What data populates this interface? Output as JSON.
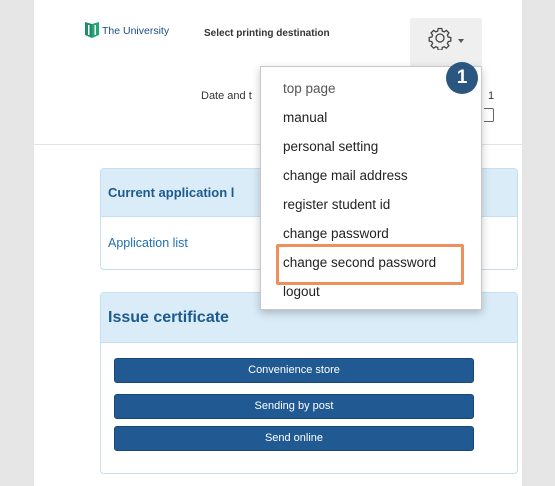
{
  "header": {
    "logo_text": "The University",
    "title": "Select printing destination",
    "settings_icon": "gear-icon"
  },
  "date": {
    "label": "Date and t",
    "suffix": "1"
  },
  "menu": {
    "items": [
      "top page",
      "manual",
      "personal setting",
      "change mail address",
      "register student id",
      "change password",
      "change second password",
      "logout"
    ],
    "highlighted_index": 6,
    "highlight_color": "#ef8f5b"
  },
  "badge": {
    "number": "1",
    "color": "#2a5680"
  },
  "current_panel": {
    "title": "Current application l",
    "link": "Application list"
  },
  "issue_panel": {
    "title": "Issue certificate",
    "buttons": [
      "Convenience store",
      "Sending by post",
      "Send online"
    ],
    "button_color": "#215a92"
  }
}
